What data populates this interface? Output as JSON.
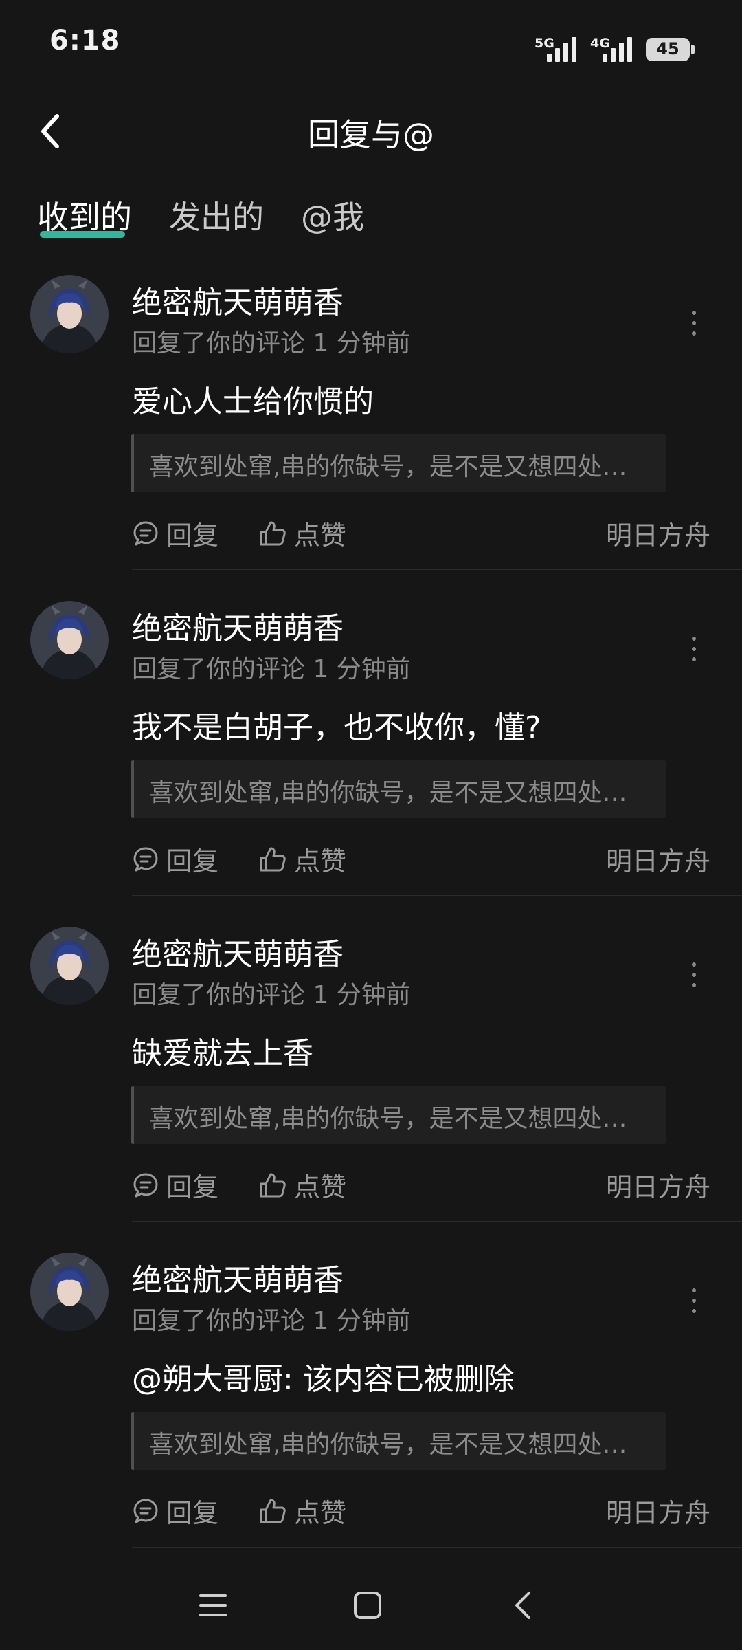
{
  "status_bar": {
    "time": "6:18",
    "network_1": "5G",
    "network_2": "4G",
    "battery": "45"
  },
  "header": {
    "title": "回复与@",
    "back_icon": "chevron-left-icon"
  },
  "tabs": [
    {
      "label": "收到的",
      "active": true
    },
    {
      "label": "发出的",
      "active": false
    },
    {
      "label": "@我",
      "active": false
    }
  ],
  "colors": {
    "background": "#161616",
    "accent": "#2fb89a",
    "secondary_text": "#8a8a8a"
  },
  "items": [
    {
      "username": "绝密航天萌萌香",
      "subline": "回复了你的评论 1 分钟前",
      "text": "爱心人士给你惯的",
      "quote": "喜欢到处窜,串的你缺号，是不是又想四处…",
      "reply_label": "回复",
      "like_label": "点赞",
      "source": "明日方舟"
    },
    {
      "username": "绝密航天萌萌香",
      "subline": "回复了你的评论 1 分钟前",
      "text": "我不是白胡子，也不收你，懂?",
      "quote": "喜欢到处窜,串的你缺号，是不是又想四处…",
      "reply_label": "回复",
      "like_label": "点赞",
      "source": "明日方舟"
    },
    {
      "username": "绝密航天萌萌香",
      "subline": "回复了你的评论 1 分钟前",
      "text": "缺爱就去上香",
      "quote": "喜欢到处窜,串的你缺号，是不是又想四处…",
      "reply_label": "回复",
      "like_label": "点赞",
      "source": "明日方舟"
    },
    {
      "username": "绝密航天萌萌香",
      "subline": "回复了你的评论 1 分钟前",
      "text": "@朔大哥厨: 该内容已被删除",
      "quote": "喜欢到处窜,串的你缺号，是不是又想四处…",
      "reply_label": "回复",
      "like_label": "点赞",
      "source": "明日方舟"
    }
  ],
  "nav_bar": {
    "icons": [
      "menu-icon",
      "home-square-icon",
      "back-chevron-icon"
    ]
  }
}
